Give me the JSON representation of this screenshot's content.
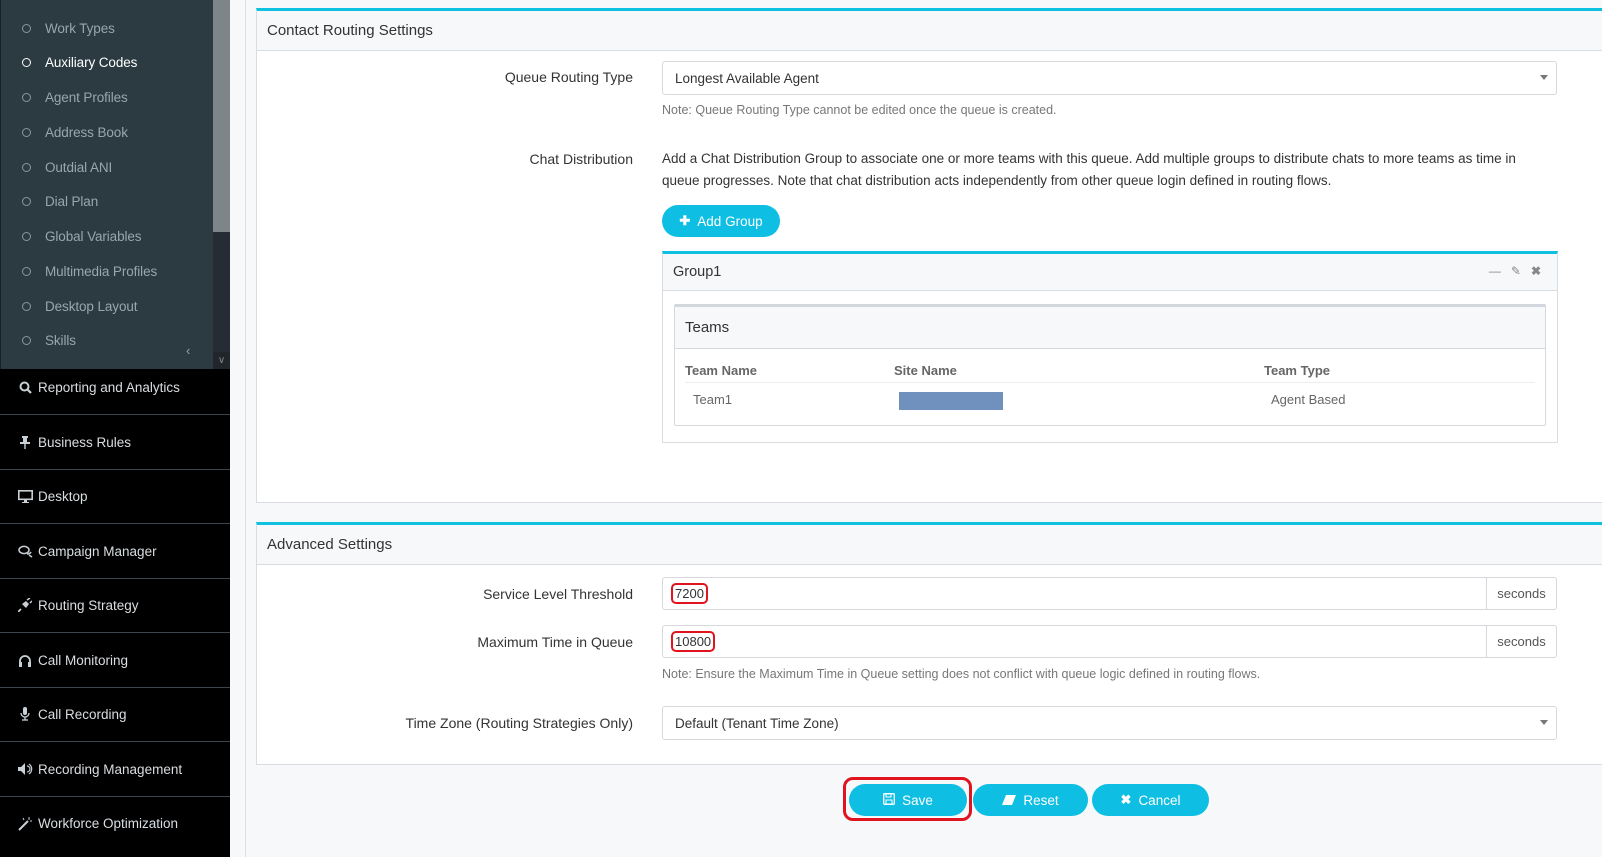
{
  "sidebar": {
    "submenu": [
      {
        "label": "Work Types",
        "active": false
      },
      {
        "label": "Auxiliary Codes",
        "active": true
      },
      {
        "label": "Agent Profiles",
        "active": false
      },
      {
        "label": "Address Book",
        "active": false
      },
      {
        "label": "Outdial ANI",
        "active": false
      },
      {
        "label": "Dial Plan",
        "active": false
      },
      {
        "label": "Global Variables",
        "active": false
      },
      {
        "label": "Multimedia Profiles",
        "active": false
      },
      {
        "label": "Desktop Layout",
        "active": false
      },
      {
        "label": "Skills",
        "active": false
      }
    ],
    "mainmenu": [
      {
        "label": "Reporting and Analytics",
        "icon": "search-icon"
      },
      {
        "label": "Business Rules",
        "icon": "pin-icon"
      },
      {
        "label": "Desktop",
        "icon": "monitor-icon"
      },
      {
        "label": "Campaign Manager",
        "icon": "comments-icon"
      },
      {
        "label": "Routing Strategy",
        "icon": "plug-icon"
      },
      {
        "label": "Call Monitoring",
        "icon": "headphones-icon"
      },
      {
        "label": "Call Recording",
        "icon": "microphone-icon"
      },
      {
        "label": "Recording Management",
        "icon": "volume-icon"
      },
      {
        "label": "Workforce Optimization",
        "icon": "magic-wand-icon"
      }
    ]
  },
  "contact_routing": {
    "title": "Contact Routing Settings",
    "queue_routing_type": {
      "label": "Queue Routing Type",
      "value": "Longest Available Agent",
      "note": "Note: Queue Routing Type cannot be edited once the queue is created."
    },
    "chat_distribution": {
      "label": "Chat Distribution",
      "description": "Add a Chat Distribution Group to associate one or more teams with this queue. Add multiple groups to distribute chats to more teams as time in queue progresses. Note that chat distribution acts independently from other queue login defined in routing flows.",
      "add_group_label": "Add Group"
    },
    "group": {
      "title": "Group1",
      "teams_title": "Teams",
      "columns": [
        "Team Name",
        "Site Name",
        "Team Type"
      ],
      "rows": [
        {
          "team_name": "Team1",
          "site_name": "[redacted]",
          "team_type": "Agent Based"
        }
      ]
    }
  },
  "advanced": {
    "title": "Advanced Settings",
    "service_level": {
      "label": "Service Level Threshold",
      "value": "7200",
      "unit": "seconds"
    },
    "max_time": {
      "label": "Maximum Time in Queue",
      "value": "10800",
      "unit": "seconds",
      "note": "Note: Ensure the Maximum Time in Queue setting does not conflict with queue logic defined in routing flows."
    },
    "time_zone": {
      "label": "Time Zone (Routing Strategies Only)",
      "value": "Default (Tenant Time Zone)"
    }
  },
  "actions": {
    "save": "Save",
    "reset": "Reset",
    "cancel": "Cancel"
  },
  "colors": {
    "accent": "#0fbfe3",
    "highlight": "#e0141e",
    "sidebar_sub": "#2c3a42",
    "sidebar_main": "#000000"
  }
}
